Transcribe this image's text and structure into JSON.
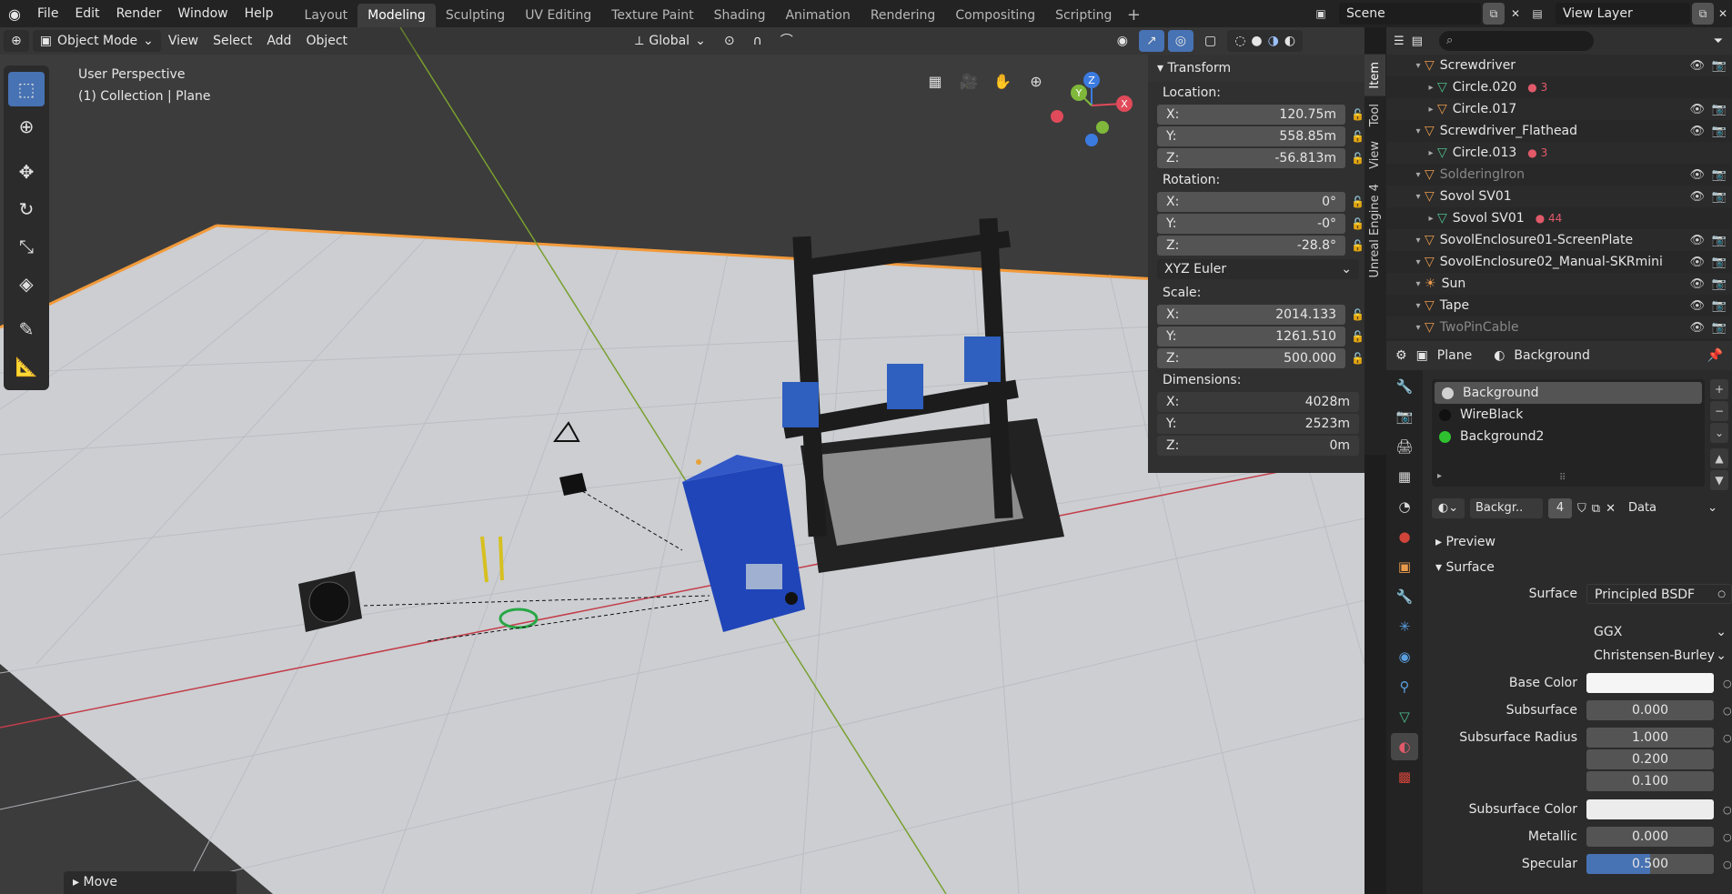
{
  "topbar": {
    "menus": [
      "File",
      "Edit",
      "Render",
      "Window",
      "Help"
    ],
    "workspaces": [
      "Layout",
      "Modeling",
      "Sculpting",
      "UV Editing",
      "Texture Paint",
      "Shading",
      "Animation",
      "Rendering",
      "Compositing",
      "Scripting"
    ],
    "active_workspace": "Modeling",
    "scene": "Scene",
    "view_layer": "View Layer"
  },
  "viewport_header": {
    "mode": "Object Mode",
    "menus": [
      "View",
      "Select",
      "Add",
      "Object"
    ],
    "transform_orientation": "Global"
  },
  "viewport": {
    "perspective": "User Perspective",
    "collection": "(1) Collection | Plane",
    "gizmo": {
      "x": "X",
      "y": "Y",
      "z": "Z"
    }
  },
  "n_panel": {
    "tabs": [
      "Item",
      "Tool",
      "View",
      "Unreal Engine 4"
    ],
    "title": "Transform",
    "location_label": "Location:",
    "location": {
      "x": "120.75m",
      "y": "558.85m",
      "z": "-56.813m"
    },
    "rotation_label": "Rotation:",
    "rotation": {
      "x": "0°",
      "y": "-0°",
      "z": "-28.8°"
    },
    "rotation_mode": "XYZ Euler",
    "scale_label": "Scale:",
    "scale": {
      "x": "2014.133",
      "y": "1261.510",
      "z": "500.000"
    },
    "dimensions_label": "Dimensions:",
    "dimensions": {
      "x": "4028m",
      "y": "2523m",
      "z": "0m"
    },
    "axis": {
      "x": "X:",
      "y": "Y:",
      "z": "Z:"
    }
  },
  "outliner": {
    "rows": [
      {
        "name": "Screwdriver",
        "indent": 2,
        "type": "obj",
        "vis": true,
        "dim": false
      },
      {
        "name": "Circle.020",
        "indent": 3,
        "type": "mesh",
        "vis": false,
        "dim": false,
        "badge": "3"
      },
      {
        "name": "Circle.017",
        "indent": 3,
        "type": "obj",
        "vis": true,
        "dim": false
      },
      {
        "name": "Screwdriver_Flathead",
        "indent": 2,
        "type": "obj",
        "vis": true,
        "dim": false
      },
      {
        "name": "Circle.013",
        "indent": 3,
        "type": "mesh",
        "vis": false,
        "dim": false,
        "badge": "3"
      },
      {
        "name": "SolderingIron",
        "indent": 2,
        "type": "obj",
        "vis": true,
        "dim": true
      },
      {
        "name": "Sovol SV01",
        "indent": 2,
        "type": "obj",
        "vis": true,
        "dim": false
      },
      {
        "name": "Sovol SV01",
        "indent": 3,
        "type": "mesh",
        "vis": false,
        "dim": false,
        "badge": "44"
      },
      {
        "name": "SovolEnclosure01-ScreenPlate",
        "indent": 2,
        "type": "obj",
        "vis": true,
        "dim": false
      },
      {
        "name": "SovolEnclosure02_Manual-SKRmini",
        "indent": 2,
        "type": "obj",
        "vis": true,
        "dim": false
      },
      {
        "name": "Sun",
        "indent": 2,
        "type": "sun",
        "vis": true,
        "dim": false
      },
      {
        "name": "Tape",
        "indent": 2,
        "type": "obj",
        "vis": true,
        "dim": false
      },
      {
        "name": "TwoPinCable",
        "indent": 2,
        "type": "obj",
        "vis": true,
        "dim": true
      }
    ]
  },
  "properties": {
    "breadcrumb_object": "Plane",
    "breadcrumb_material": "Background",
    "materials": [
      {
        "name": "Background",
        "color": "#d0d0d0",
        "active": true
      },
      {
        "name": "WireBlack",
        "color": "#111111",
        "active": false
      },
      {
        "name": "Background2",
        "color": "#2fc12f",
        "active": false
      }
    ],
    "material_name": "Backgr..",
    "users": "4",
    "link": "Data",
    "preview_label": "Preview",
    "surface_section": "Surface",
    "surface_label": "Surface",
    "surface_value": "Principled BSDF",
    "distribution": "GGX",
    "sss_method": "Christensen-Burley",
    "base_color_label": "Base Color",
    "subsurface_label": "Subsurface",
    "subsurface_value": "0.000",
    "subsurface_radius_label": "Subsurface Radius",
    "subsurface_radius": [
      "1.000",
      "0.200",
      "0.100"
    ],
    "subsurface_color_label": "Subsurface Color",
    "metallic_label": "Metallic",
    "metallic_value": "0.000",
    "specular_label": "Specular",
    "specular_value": "0.500",
    "specular_fraction": 0.5
  },
  "status": {
    "operation": "Move"
  },
  "colors": {
    "accent": "#4772b3",
    "object": "#e89a4c",
    "mesh": "#4fc08d"
  }
}
